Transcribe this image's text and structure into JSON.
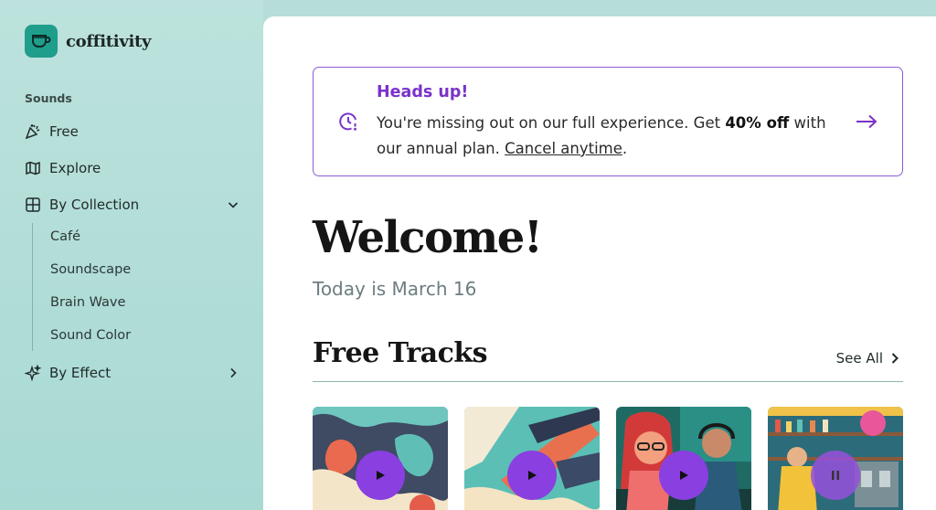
{
  "brand": {
    "name": "coffitivity",
    "logo_icon": "coffee-cup-icon",
    "logo_color": "#1f9e8c"
  },
  "sidebar": {
    "section_label": "Sounds",
    "items": [
      {
        "label": "Free",
        "icon": "party-popper-icon"
      },
      {
        "label": "Explore",
        "icon": "map-icon"
      },
      {
        "label": "By Collection",
        "icon": "grid-icon",
        "expanded": true
      },
      {
        "label": "By Effect",
        "icon": "sparkle-icon",
        "expanded": false
      }
    ],
    "collection_items": [
      "Café",
      "Soundscape",
      "Brain Wave",
      "Sound Color"
    ]
  },
  "banner": {
    "title": "Heads up!",
    "text_before": "You're missing out on our full experience. Get ",
    "highlight": "40% off",
    "text_after": " with our annual plan. ",
    "link": "Cancel anytime",
    "text_end": ".",
    "accent_color": "#7a32c9"
  },
  "main": {
    "welcome": "Welcome!",
    "today": "Today is March 16",
    "tracks_title": "Free Tracks",
    "see_all": "See All"
  },
  "tracks": [
    {
      "state": "play"
    },
    {
      "state": "play"
    },
    {
      "state": "play"
    },
    {
      "state": "pause"
    }
  ],
  "colors": {
    "sidebar_bg": "#b6ddd8",
    "accent_purple": "#8a3fe0"
  }
}
